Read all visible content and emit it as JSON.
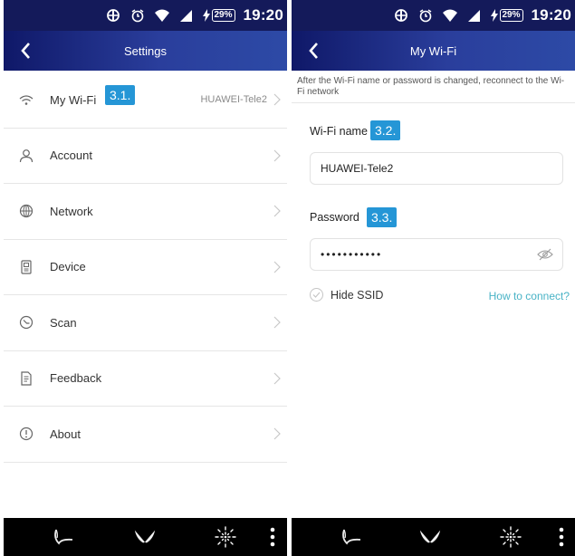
{
  "status_bar": {
    "time": "19:20",
    "battery": "29%",
    "icons": [
      "data-sync-icon",
      "alarm-icon",
      "wifi-icon",
      "signal-icon",
      "charging-icon"
    ]
  },
  "left_screen": {
    "title": "Settings",
    "items": [
      {
        "label": "My Wi-Fi",
        "value": "HUAWEI-Tele2",
        "icon": "wifi-icon"
      },
      {
        "label": "Account",
        "value": "",
        "icon": "user-icon"
      },
      {
        "label": "Network",
        "value": "",
        "icon": "globe-icon"
      },
      {
        "label": "Device",
        "value": "",
        "icon": "device-icon"
      },
      {
        "label": "Scan",
        "value": "",
        "icon": "scan-icon"
      },
      {
        "label": "Feedback",
        "value": "",
        "icon": "feedback-icon"
      },
      {
        "label": "About",
        "value": "",
        "icon": "info-icon"
      }
    ],
    "badge": "3.1."
  },
  "right_screen": {
    "title": "My Wi-Fi",
    "hint": "After the Wi-Fi name or password is changed, reconnect to the Wi-Fi network",
    "wifi_name_label": "Wi-Fi name",
    "wifi_name_value": "HUAWEI-Tele2",
    "wifi_name_badge": "3.2.",
    "password_label": "Password",
    "password_value": "•••••••••••",
    "password_badge": "3.3.",
    "hide_ssid_label": "Hide SSID",
    "help_link": "How to connect?"
  },
  "bottom_nav": {
    "icons": [
      "swan-logo-icon",
      "butterfly-logo-icon",
      "firework-icon",
      "more-vertical-icon"
    ]
  },
  "colors": {
    "status_bar": "#141a5a",
    "nav_start": "#0f1868",
    "nav_end": "#2d4aa6",
    "badge": "#2596d6",
    "link": "#49b3c6"
  }
}
